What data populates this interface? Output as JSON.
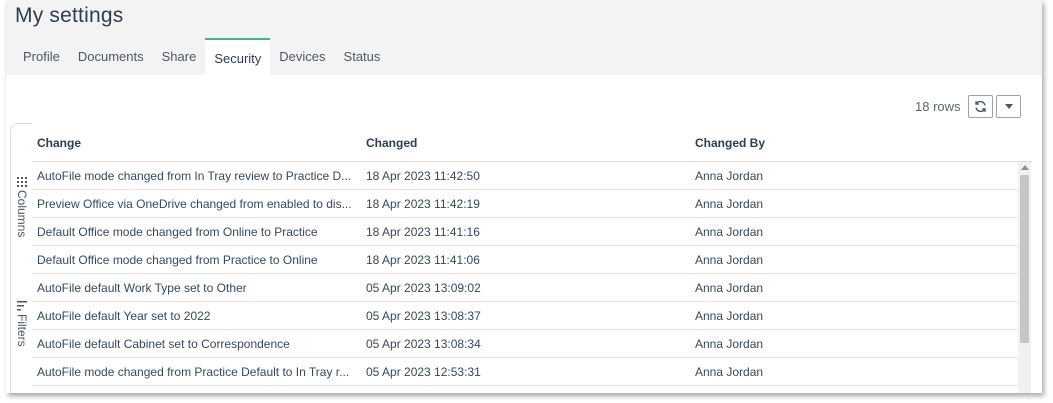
{
  "page": {
    "title": "My settings"
  },
  "tabs": [
    {
      "label": "Profile"
    },
    {
      "label": "Documents"
    },
    {
      "label": "Share"
    },
    {
      "label": "Security",
      "active": true
    },
    {
      "label": "Devices"
    },
    {
      "label": "Status"
    }
  ],
  "toolbar": {
    "rows_count": "18 rows",
    "refresh_icon": "refresh-icon",
    "dropdown_icon": "caret-down-icon"
  },
  "side_panel": {
    "columns_label": "Columns",
    "filters_label": "Filters"
  },
  "grid": {
    "columns": [
      "Change",
      "Changed",
      "Changed By"
    ],
    "rows": [
      {
        "change": "AutoFile mode changed from In Tray review to Practice D...",
        "changed": "18 Apr 2023 11:42:50",
        "changed_by": "Anna Jordan"
      },
      {
        "change": "Preview Office via OneDrive changed from enabled to dis...",
        "changed": "18 Apr 2023 11:42:19",
        "changed_by": "Anna Jordan"
      },
      {
        "change": "Default Office mode changed from Online to Practice",
        "changed": "18 Apr 2023 11:41:16",
        "changed_by": "Anna Jordan"
      },
      {
        "change": "Default Office mode changed from Practice to Online",
        "changed": "18 Apr 2023 11:41:06",
        "changed_by": "Anna Jordan"
      },
      {
        "change": "AutoFile default Work Type set to Other",
        "changed": "05 Apr 2023 13:09:02",
        "changed_by": "Anna Jordan"
      },
      {
        "change": "AutoFile default Year set to 2022",
        "changed": "05 Apr 2023 13:08:37",
        "changed_by": "Anna Jordan"
      },
      {
        "change": "AutoFile default Cabinet set to Correspondence",
        "changed": "05 Apr 2023 13:08:34",
        "changed_by": "Anna Jordan"
      },
      {
        "change": "AutoFile mode changed from Practice Default to In Tray r...",
        "changed": "05 Apr 2023 12:53:31",
        "changed_by": "Anna Jordan"
      }
    ]
  },
  "colors": {
    "accent": "#3cb29c",
    "header_bg": "#f3f3f4",
    "text": "#34495e"
  }
}
